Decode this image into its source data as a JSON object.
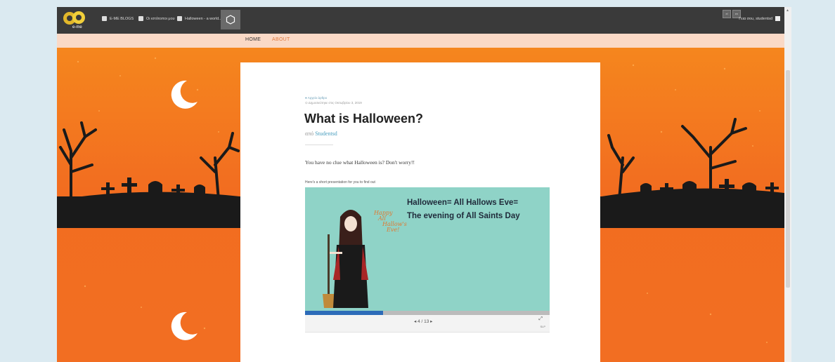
{
  "admin_bar": {
    "items": [
      {
        "label": "E-ME BLOGS",
        "icon": "blog-icon"
      },
      {
        "label": "Οι ιστότοποι μου",
        "icon": "sites-icon"
      },
      {
        "label": "Halloween - a world...",
        "icon": "dashboard-icon"
      }
    ],
    "user_label": "Γεια σου, studentsd"
  },
  "nav": {
    "items": [
      "HOME",
      "ABOUT"
    ]
  },
  "post": {
    "category": "Αρχείο άρθρο",
    "date": "Δημοσιεύτηκε στις Οκτωβρίου 3, 2019",
    "title": "What is Halloween?",
    "byline_prefix": "από",
    "author": "Studentsd",
    "intro": "You have no clue what Halloween is? Don't worry!!",
    "small_text": "Here's a short presentation for you to find out"
  },
  "slideshow": {
    "heading_line1": "Halloween= All Hallows Eve=",
    "heading_line2": "The evening of All Saints Day",
    "handwritten": [
      "Happy",
      "All",
      "Hallow's",
      "Eve!"
    ],
    "pager": "◂ 4 / 13 ▸",
    "progress": 0.32,
    "badge": "SLP"
  },
  "colors": {
    "accent": "#f26e22",
    "nav_bg": "#fad9c6",
    "admin_bg": "#3a3a3a",
    "slide_bg": "#8fd3c7",
    "link": "#4a9fbf"
  }
}
